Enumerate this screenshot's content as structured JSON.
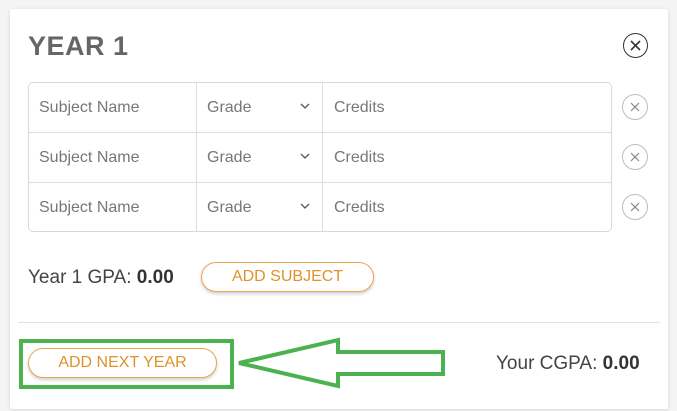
{
  "year": {
    "title": "YEAR 1",
    "rows": [
      {
        "name_placeholder": "Subject  Name",
        "grade_placeholder": "Grade",
        "credits_placeholder": "Credits"
      },
      {
        "name_placeholder": "Subject  Name",
        "grade_placeholder": "Grade",
        "credits_placeholder": "Credits"
      },
      {
        "name_placeholder": "Subject  Name",
        "grade_placeholder": "Grade",
        "credits_placeholder": "Credits"
      }
    ],
    "gpa_label": "Year 1 GPA:",
    "gpa_value": "0.00",
    "add_subject_label": "ADD SUBJECT"
  },
  "footer": {
    "add_next_year_label": "ADD NEXT YEAR",
    "cgpa_label": "Your CGPA:",
    "cgpa_value": "0.00"
  },
  "colors": {
    "accent": "#e0922a",
    "highlight": "#4cb24f"
  },
  "icons": [
    "close-icon",
    "chevron-down-icon",
    "arrow-left-outline-icon"
  ]
}
